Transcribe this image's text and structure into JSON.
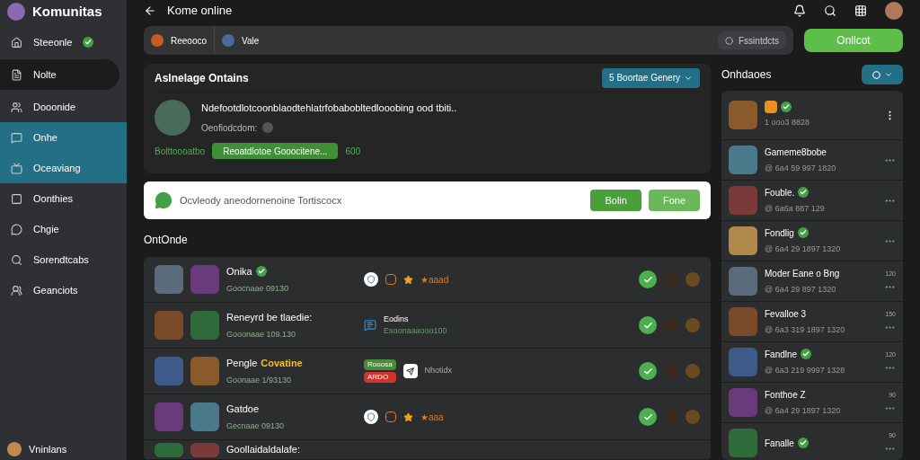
{
  "sidebar": {
    "app_title": "Komunitas",
    "items": [
      {
        "label": "Steeonle",
        "selected": false,
        "focused": false,
        "verified": true
      },
      {
        "label": "Nolte",
        "selected": false,
        "focused": true,
        "verified": false
      },
      {
        "label": "Dooonide",
        "selected": false,
        "focused": false,
        "verified": false
      },
      {
        "label": "Onhe",
        "selected": true,
        "focused": false,
        "verified": false
      },
      {
        "label": "Oceaviang",
        "selected": true,
        "focused": false,
        "verified": false
      },
      {
        "label": "Oonthies",
        "selected": false,
        "focused": false,
        "verified": false
      },
      {
        "label": "Chgie",
        "selected": false,
        "focused": false,
        "verified": false
      },
      {
        "label": "Sorendtcabs",
        "selected": false,
        "focused": false,
        "verified": false
      },
      {
        "label": "Geanciots",
        "selected": false,
        "focused": false,
        "verified": false
      }
    ],
    "user": "Vninlans"
  },
  "header": {
    "title": "Kome online"
  },
  "filter_bar": {
    "chips": [
      "Reeooco",
      "Vale"
    ],
    "right_chip": "Fssintdcts",
    "button": "Onllcot"
  },
  "activity": {
    "title": "Aslnelage Ontains",
    "button": "5 Boortae Genery",
    "post": {
      "text": "Ndefootdlotcoonblaodtehlatrfobabobltedlooobing ood tbiti..",
      "sub": "Oeofiodcdom:",
      "label": "Bolttoooatbo",
      "action": "Reoatdlotoe Gooocitene...",
      "count": "600"
    }
  },
  "compose": {
    "placeholder": "Ocvleody aneodornenoine Tortiscocx",
    "buttons": [
      "Bolin",
      "Fone"
    ]
  },
  "section": {
    "title": "OntOnde",
    "rows": [
      {
        "kind": "rating",
        "name": "Onika",
        "verified": true,
        "sub": "Goocnaae 09130",
        "rating": "★aaad"
      },
      {
        "kind": "chat",
        "name": "Reneyrd be tlaedie:",
        "verified": false,
        "sub": "Gooonaae 109.130",
        "chat_title": "Eodins",
        "chat_sub": "Esoonaaaooo100"
      },
      {
        "kind": "app",
        "name": "Pengle",
        "highlight": "Covatine",
        "tags": [
          {
            "label": "Rooosa",
            "color": "#4b8a3c"
          },
          {
            "label": "ARDO",
            "color": "#d0342c"
          }
        ],
        "verified": false,
        "sub": "Goonaae 1/93130",
        "app_text": "Nhotidx"
      },
      {
        "kind": "rating",
        "name": "Gatdoe",
        "verified": false,
        "sub": "Gecnaae 09130",
        "rating": "★aaa"
      },
      {
        "kind": "cut",
        "name": "Goollaidaldalafe:",
        "verified": false
      }
    ]
  },
  "online": {
    "title": "Onhdaoes",
    "items": [
      {
        "sub": "1 ooo3 8828",
        "verified": true,
        "menu": true
      },
      {
        "name": "Gameme8bobe",
        "verified": false,
        "sub": "@ 6a4 59 997 1820"
      },
      {
        "name": "Fouble.",
        "verified": true,
        "sub": "@ 6a6a 887 129"
      },
      {
        "name": "Fondlig",
        "verified": true,
        "sub": "@ 6a4 29 1897 1320"
      },
      {
        "name": "Moder Eane o Bng",
        "verified": false,
        "sub": "@ 6a4 29 897 1320",
        "time": "120"
      },
      {
        "name": "Fevalloe 3",
        "verified": false,
        "sub": "@ 6a3 319 1897 1320",
        "time": "150"
      },
      {
        "name": "Fandlne",
        "verified": true,
        "sub": "@ 6a3 219 9997 1328",
        "time": "120"
      },
      {
        "name": "Fonthoe Z",
        "verified": false,
        "sub": "@ 6a4 29 1897 1320",
        "time": "90"
      },
      {
        "name": "Fanalle",
        "verified": true,
        "time": "90"
      }
    ]
  }
}
